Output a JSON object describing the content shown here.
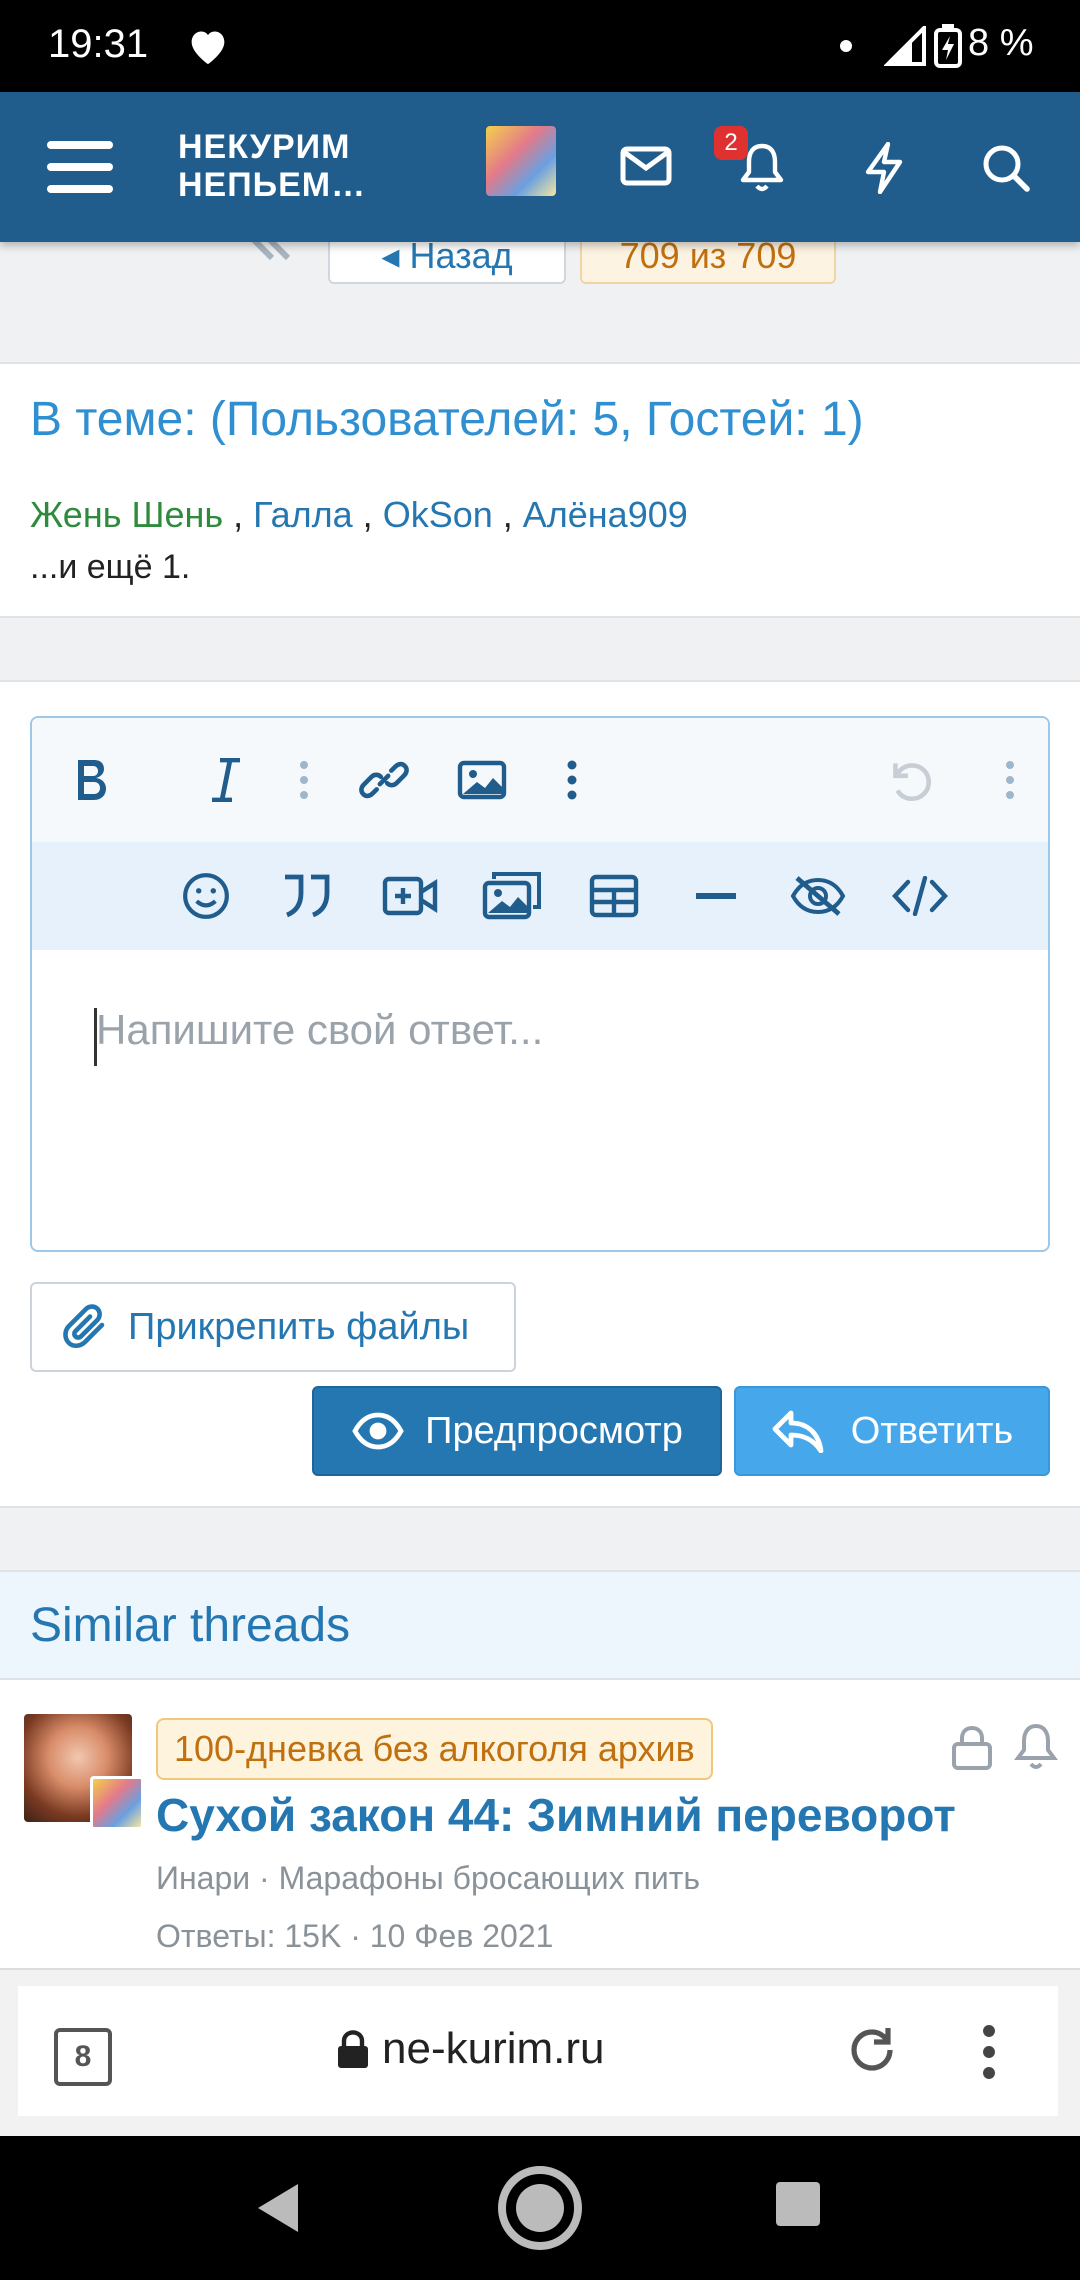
{
  "status_bar": {
    "time": "19:31",
    "battery_percent": "8 %"
  },
  "top_nav": {
    "site_title_line1": "НЕКУРИМ",
    "site_title_line2": "НЕПЬЕМ…",
    "notification_count": "2"
  },
  "pagination": {
    "back_label": "◂ Назад",
    "page_label": "709 из 709"
  },
  "online": {
    "title": "В теме: (Пользователей: 5, Гостей: 1)",
    "users": [
      {
        "name": "Жень Шень",
        "color": "#2e8b3e"
      },
      {
        "name": "Галла",
        "color": "#2577b1"
      },
      {
        "name": "OkSon",
        "color": "#2577b1"
      },
      {
        "name": "Алёна909",
        "color": "#2577b1"
      }
    ],
    "more": "...и ещё 1."
  },
  "editor": {
    "placeholder": "Напишите свой ответ..."
  },
  "buttons": {
    "attach": "Прикрепить файлы",
    "preview": "Предпросмотр",
    "reply": "Ответить"
  },
  "similar": {
    "title": "Similar threads",
    "thread": {
      "prefix": "100-дневка без алкоголя архив",
      "title": "Сухой закон 44: Зимний переворот",
      "author_forum": "Инари · Марафоны бросающих пить",
      "stats": "Ответы: 15K · 10 Фев 2021"
    }
  },
  "browser": {
    "tab_count": "8",
    "url": "ne-kurim.ru"
  },
  "colors": {
    "nav_bg": "#205d8c",
    "link_blue": "#2577b1",
    "accent_light": "#47a7eb",
    "online_green": "#2e8b3e"
  }
}
